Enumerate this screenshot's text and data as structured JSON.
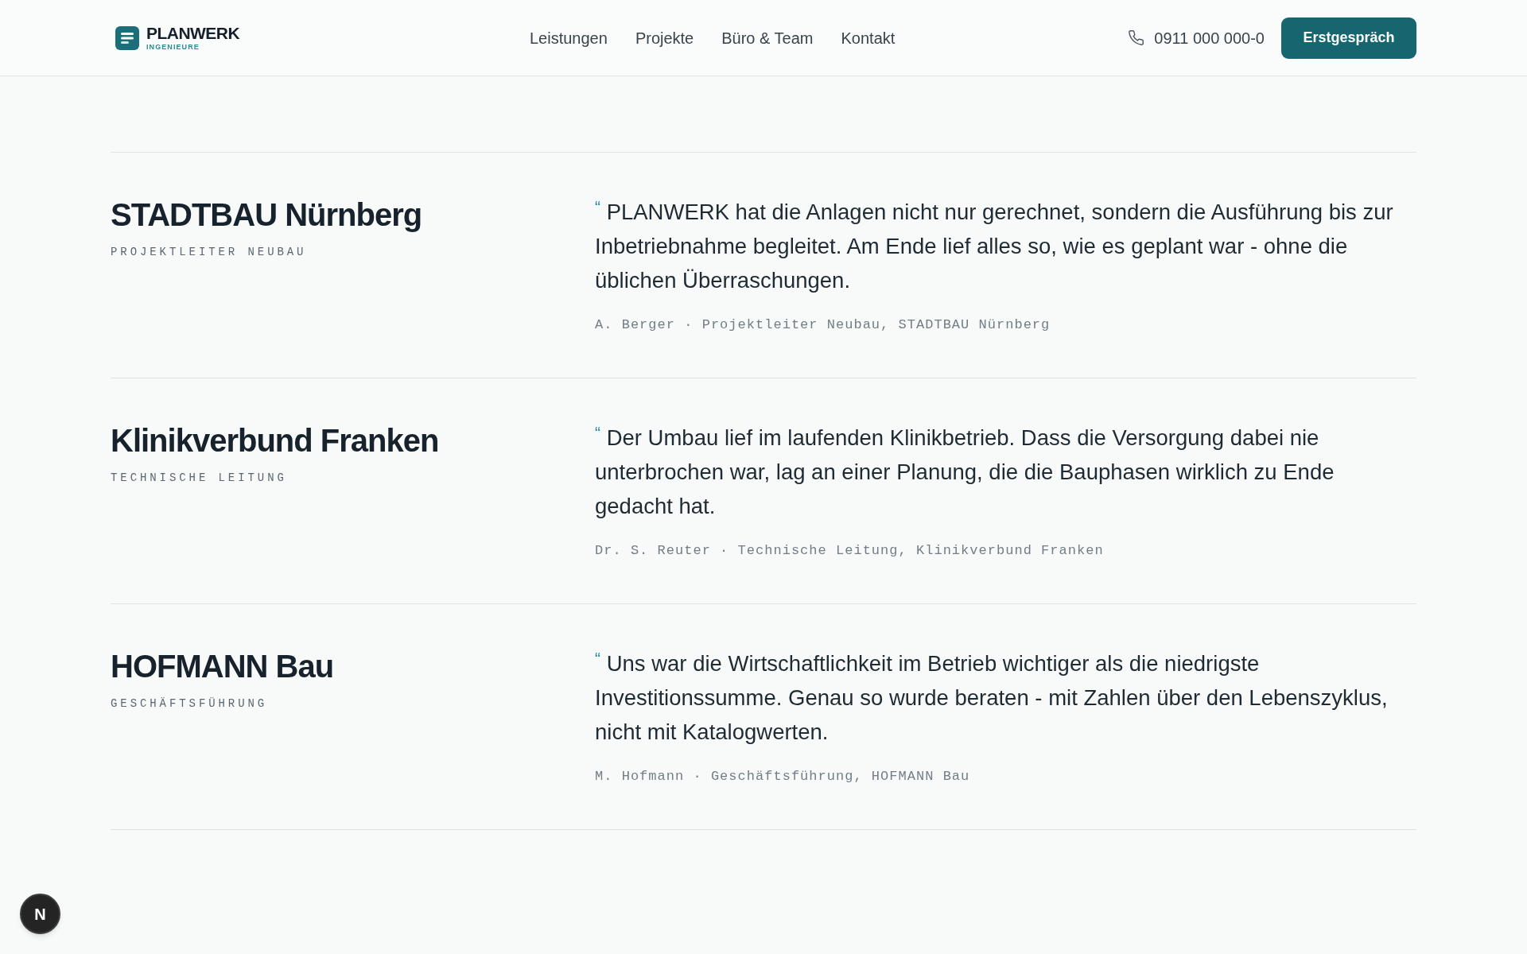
{
  "header": {
    "logo": {
      "name": "PLANWERK",
      "tagline": "INGENIEURE"
    },
    "nav": [
      {
        "label": "Leistungen"
      },
      {
        "label": "Projekte"
      },
      {
        "label": "Büro & Team"
      },
      {
        "label": "Kontakt"
      }
    ],
    "phone": "0911 000 000-0",
    "cta": "Erstgespräch"
  },
  "testimonials": [
    {
      "organization": "STADTBAU Nürnberg",
      "role": "PROJEKTLEITER NEUBAU",
      "open_quote": "“",
      "quote": "PLANWERK hat die Anlagen nicht nur gerechnet, sondern die Ausführung bis zur Inbetriebnahme begleitet. Am Ende lief alles so, wie es geplant war - ohne die üblichen Überraschungen.",
      "attribution": "A. Berger · Projektleiter Neubau, STADTBAU Nürnberg"
    },
    {
      "organization": "Klinikverbund Franken",
      "role": "TECHNISCHE LEITUNG",
      "open_quote": "“",
      "quote": "Der Umbau lief im laufenden Klinikbetrieb. Dass die Versorgung dabei nie unterbrochen war, lag an einer Planung, die die Bauphasen wirklich zu Ende gedacht hat.",
      "attribution": "Dr. S. Reuter · Technische Leitung, Klinikverbund Franken"
    },
    {
      "organization": "HOFMANN Bau",
      "role": "GESCHÄFTSFÜHRUNG",
      "open_quote": "“",
      "quote": "Uns war die Wirtschaftlichkeit im Betrieb wichtiger als die niedrigste Investitionssumme. Genau so wurde beraten - mit Zahlen über den Lebenszyklus, nicht mit Katalogwerten.",
      "attribution": "M. Hofmann · Geschäftsführung, HOFMANN Bau"
    }
  ],
  "dev_indicator": {
    "label": "N"
  }
}
